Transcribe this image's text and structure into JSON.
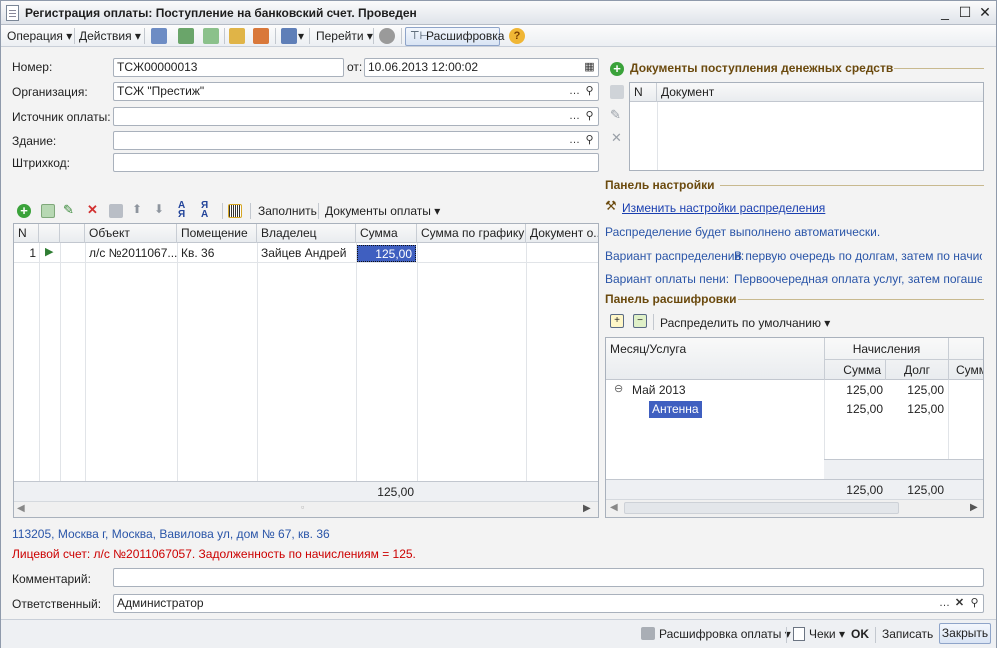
{
  "window": {
    "title": "Регистрация оплаты: Поступление на банковский счет. Проведен",
    "min": "_",
    "max": "☐",
    "close": "✕"
  },
  "toolbar": {
    "operation": "Операция",
    "actions": "Действия",
    "goto": "Перейти",
    "decode": "Расшифровка",
    "help": "?"
  },
  "header": {
    "number_label": "Номер:",
    "number_value": "ТСЖ00000013",
    "date_label": "от:",
    "date_value": "10.06.2013 12:00:02",
    "org_label": "Организация:",
    "org_value": "ТСЖ \"Престиж\"",
    "source_label": "Источник оплаты:",
    "source_value": "",
    "building_label": "Здание:",
    "building_value": "",
    "barcode_label": "Штрихкод:",
    "barcode_value": ""
  },
  "table_toolbar": {
    "fill": "Заполнить",
    "payment_docs": "Документы оплаты"
  },
  "table": {
    "columns": [
      "N",
      "",
      "",
      "Объект",
      "Помещение",
      "Владелец",
      "Сумма",
      "Сумма по графику",
      "Документ о..."
    ],
    "rows": [
      {
        "n": "1",
        "object": "л/с №2011067...",
        "room": "Кв. 36",
        "owner": "Зайцев Андрей",
        "sum": "125,00",
        "sum_schedule": "",
        "doc": ""
      }
    ],
    "total_sum": "125,00"
  },
  "info": {
    "address": "113205, Москва г, Москва, Вавилова ул, дом № 67, кв. 36",
    "account": "Лицевой счет: л/с №2011067057. Задолженность по начислениям = 125."
  },
  "footer_fields": {
    "comment_label": "Комментарий:",
    "comment_value": "",
    "responsible_label": "Ответственный:",
    "responsible_value": "Администратор"
  },
  "right_panel": {
    "docs_title": "Документы поступления денежных средств",
    "docs_col_n": "N",
    "docs_col_doc": "Документ",
    "settings_title": "Панель настройки",
    "settings_link": "Изменить настройки распределения",
    "auto_text": "Распределение будет выполнено автоматически.",
    "variant_label": "Вариант распределения:",
    "variant_value": "В первую очередь по долгам, затем по начисл...",
    "penalty_label": "Вариант оплаты пени:",
    "penalty_value": "Первоочередная оплата услуг, затем погашен...",
    "decode_title": "Панель расшифровки",
    "distribute_default": "Распределить по умолчанию",
    "tree_col_month": "Месяц/Услуга",
    "tree_col_accruals": "Начисления",
    "tree_col_sum": "Сумма",
    "tree_col_debt": "Долг",
    "tree_col_sum2": "Сумм",
    "tree_rows": [
      {
        "label": "Май 2013",
        "sum": "125,00",
        "debt": "125,00"
      },
      {
        "label": "Антенна",
        "sum": "125,00",
        "debt": "125,00"
      }
    ],
    "tree_total_sum": "125,00",
    "tree_total_debt": "125,00"
  },
  "bottom": {
    "decode_payment": "Расшифровка оплаты",
    "checks": "Чеки",
    "ok": "OK",
    "save": "Записать",
    "close": "Закрыть"
  },
  "colors": {
    "accent": "#3f5fc0",
    "section": "#6b4a0e",
    "link": "#1a3fb0",
    "warning": "#cc0000"
  }
}
